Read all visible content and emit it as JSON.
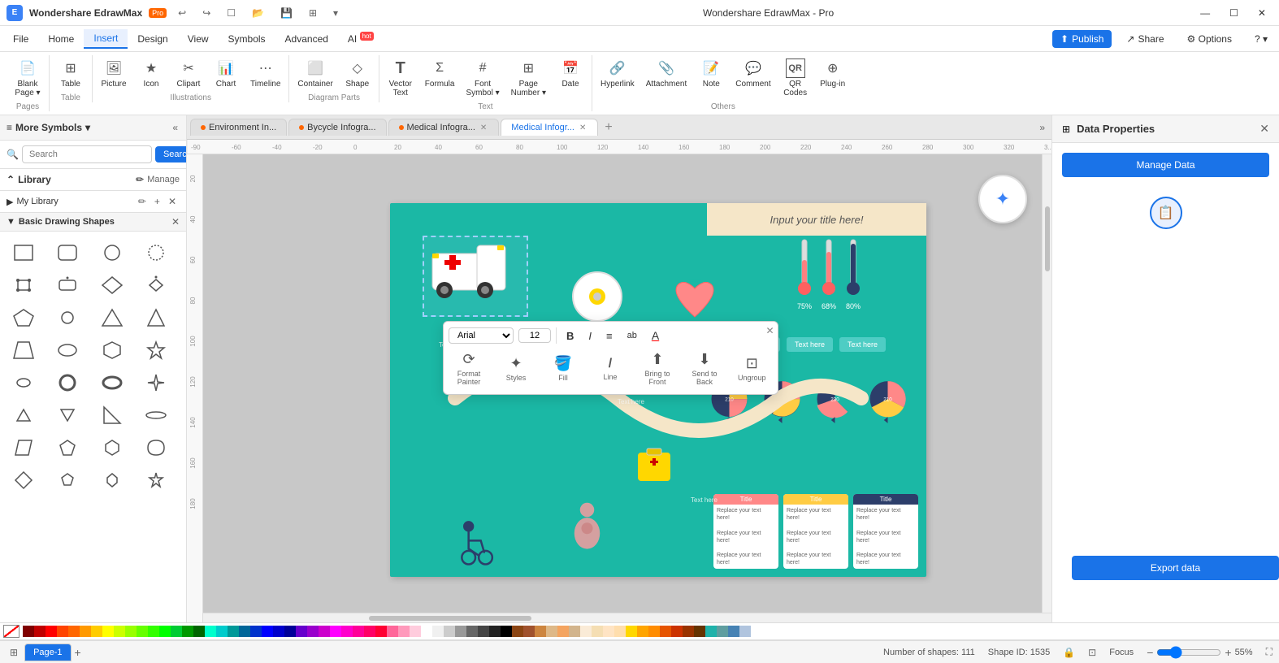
{
  "app": {
    "name": "Wondershare EdrawMax",
    "edition": "Pro",
    "title": "Wondershare EdrawMax - Pro"
  },
  "titlebar": {
    "undo_label": "↩",
    "redo_label": "↪",
    "new_label": "☐",
    "open_label": "📁",
    "save_label": "💾",
    "template_label": "⊞",
    "more_label": "▾",
    "close": "✕",
    "minimize": "—",
    "maximize": "☐"
  },
  "menubar": {
    "items": [
      "File",
      "Home",
      "Insert",
      "Design",
      "View",
      "Symbols",
      "Advanced"
    ],
    "active_index": 2,
    "right_items": [
      "Publish",
      "Share",
      "Options",
      "?▾"
    ]
  },
  "toolbar": {
    "groups": [
      {
        "label": "Pages",
        "items": [
          {
            "icon": "📄",
            "label": "Blank\nPage",
            "has_arrow": true
          }
        ]
      },
      {
        "label": "Table",
        "items": [
          {
            "icon": "⊞",
            "label": "Table"
          }
        ]
      },
      {
        "label": "Illustrations",
        "items": [
          {
            "icon": "🖼",
            "label": "Picture"
          },
          {
            "icon": "★",
            "label": "Icon"
          },
          {
            "icon": "✂",
            "label": "Clipart"
          },
          {
            "icon": "📈",
            "label": "Chart"
          },
          {
            "icon": "⋮",
            "label": "Timeline"
          }
        ]
      },
      {
        "label": "Diagram Parts",
        "items": [
          {
            "icon": "⬜",
            "label": "Container"
          },
          {
            "icon": "◇",
            "label": "Shape"
          }
        ]
      },
      {
        "label": "Text",
        "items": [
          {
            "icon": "T",
            "label": "Vector\nText"
          },
          {
            "icon": "Σ",
            "label": "Formula"
          },
          {
            "icon": "#",
            "label": "Font\nSymbol"
          },
          {
            "icon": "⊞",
            "label": "Page\nNumber"
          },
          {
            "icon": "📅",
            "label": "Date"
          }
        ]
      },
      {
        "label": "Others",
        "items": [
          {
            "icon": "🔗",
            "label": "Hyperlink"
          },
          {
            "icon": "📎",
            "label": "Attachment"
          },
          {
            "icon": "📝",
            "label": "Note"
          },
          {
            "icon": "💬",
            "label": "Comment"
          },
          {
            "icon": "QR",
            "label": "QR\nCodes"
          },
          {
            "icon": "⊕",
            "label": "Plug-in"
          }
        ]
      }
    ]
  },
  "sidebar": {
    "title": "More Symbols",
    "search_placeholder": "Search",
    "search_btn": "Search",
    "library_label": "Library",
    "manage_label": "Manage",
    "my_library_label": "My Library",
    "basic_shapes_label": "Basic Drawing Shapes",
    "shapes": [
      {
        "type": "square"
      },
      {
        "type": "rounded-rect"
      },
      {
        "type": "circle"
      },
      {
        "type": "circle-outline"
      },
      {
        "type": "square-small"
      },
      {
        "type": "rounded-rect-small"
      },
      {
        "type": "diamond"
      },
      {
        "type": "diamond-small"
      },
      {
        "type": "pentagon"
      },
      {
        "type": "circle-sm"
      },
      {
        "type": "triangle"
      },
      {
        "type": "triangle-r"
      },
      {
        "type": "trapezoid"
      },
      {
        "type": "circle-tiny"
      },
      {
        "type": "hexagon"
      },
      {
        "type": "star"
      },
      {
        "type": "oval-h"
      },
      {
        "type": "circle-ring"
      },
      {
        "type": "oval-ring"
      },
      {
        "type": "star-4"
      },
      {
        "type": "triangle-sm"
      },
      {
        "type": "tri-sm2"
      },
      {
        "type": "right-tri"
      },
      {
        "type": "oval-flat"
      },
      {
        "type": "skewed"
      },
      {
        "type": "pentagon-sm"
      },
      {
        "type": "hex-sm"
      },
      {
        "type": "leaf"
      },
      {
        "type": "diamond-lg"
      },
      {
        "type": "pentagon-tiny"
      },
      {
        "type": "hex-tiny"
      },
      {
        "type": "star-sm"
      }
    ]
  },
  "tabs": [
    {
      "label": "Environment In...",
      "dot": true,
      "active": false
    },
    {
      "label": "Bycycle Infogra...",
      "dot": true,
      "active": false
    },
    {
      "label": "Medical Infogra...",
      "dot": true,
      "active": false
    },
    {
      "label": "Medical Infogr...",
      "dot": false,
      "active": true
    }
  ],
  "float_toolbar": {
    "font": "Arial",
    "size": "12",
    "bold": "B",
    "italic": "I",
    "align": "≡",
    "case": "ab",
    "font_color": "A",
    "tools": [
      {
        "icon": "⟳",
        "label": "Format\nPainter"
      },
      {
        "icon": "✦",
        "label": "Styles"
      },
      {
        "icon": "🪣",
        "label": "Fill"
      },
      {
        "icon": "/",
        "label": "Line"
      },
      {
        "icon": "⬆",
        "label": "Bring to\nFront"
      },
      {
        "icon": "⬇",
        "label": "Send to\nBack"
      },
      {
        "icon": "⊡",
        "label": "Ungroup"
      }
    ],
    "close": "✕"
  },
  "right_panel": {
    "title": "Data Properties",
    "close": "✕",
    "manage_data_btn": "Manage Data",
    "export_data_btn": "Export data"
  },
  "status_bar": {
    "page_label": "Page-1",
    "shapes_label": "Number of shapes: 111",
    "shape_id_label": "Shape ID: 1535",
    "focus_label": "Focus",
    "zoom_level": "55%",
    "page_tab": "Page-1"
  },
  "colors": {
    "accent_blue": "#1a73e8",
    "canvas_teal": "#1bb8a5",
    "pro_orange": "#ff6600"
  },
  "palette": [
    "#8B0000",
    "#B22222",
    "#DC143C",
    "#FF0000",
    "#FF4500",
    "#FF6347",
    "#FF7F50",
    "#FFA500",
    "#FFD700",
    "#FFFF00",
    "#ADFF2F",
    "#7FFF00",
    "#00FF00",
    "#32CD32",
    "#008000",
    "#006400",
    "#00FFFF",
    "#00CED1",
    "#008B8B",
    "#4169E1",
    "#0000FF",
    "#00008B",
    "#8A2BE2",
    "#9400D3",
    "#FF00FF",
    "#FF69B4",
    "#FFB6C1",
    "#FFC0CB",
    "#FFFFFF",
    "#F5F5F5",
    "#DCDCDC",
    "#C0C0C0",
    "#A9A9A9",
    "#808080",
    "#696969",
    "#000000",
    "#8B4513",
    "#A0522D",
    "#CD853F",
    "#DEB887",
    "#F4A460",
    "#D2B48C",
    "#FAEBD7",
    "#FFF8DC",
    "#FFFFF0",
    "#F0FFF0",
    "#F0FFFF",
    "#F0F8FF",
    "#E6E6FA",
    "#FFF0F5",
    "#FFE4E1",
    "#FFF5EE",
    "#FAFAD2",
    "#FFEFD5",
    "#FFEBCD",
    "#FFE4B5",
    "#FFDAB9",
    "#EEE8AA",
    "#F0E68C",
    "#BDB76B",
    "#808000",
    "#556B2F",
    "#6B8E23",
    "#228B22",
    "#2E8B57",
    "#3CB371",
    "#66CDAA",
    "#8FBC8F",
    "#90EE90",
    "#98FB98",
    "#00FA9A",
    "#00FF7F",
    "#7CFC00",
    "#9ACD32",
    "#6DBB5E",
    "#4DBD33",
    "#20B2AA",
    "#5F9EA0",
    "#4682B4",
    "#B0C4DE"
  ]
}
